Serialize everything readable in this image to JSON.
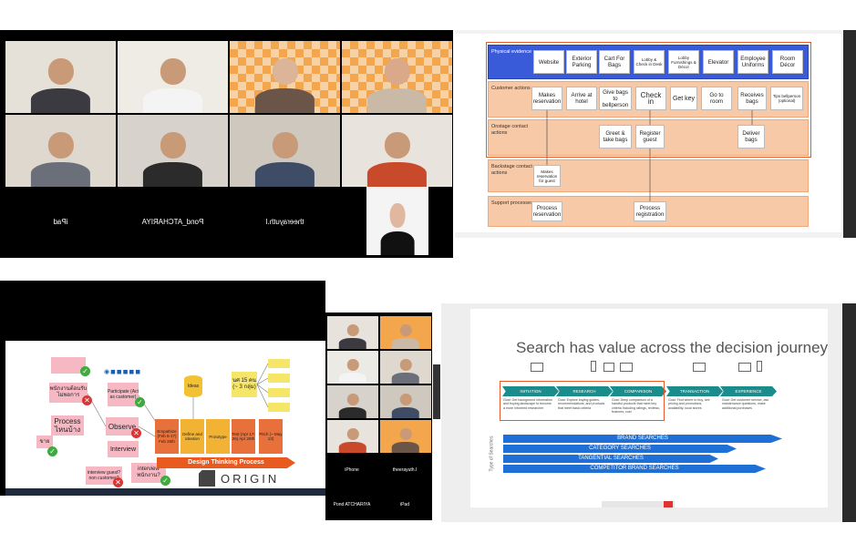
{
  "zoom1": {
    "tiles": [
      {
        "name": "",
        "footer": ""
      },
      {
        "name": "",
        "footer": ""
      },
      {
        "name": "",
        "footer": ""
      },
      {
        "name": "",
        "footer": ""
      },
      {
        "name": "",
        "footer": ""
      },
      {
        "name": "",
        "footer": ""
      },
      {
        "name": "",
        "footer": ""
      },
      {
        "name": "",
        "footer": ""
      }
    ],
    "bottom_names": [
      "iPad",
      "Pond_ATCHARIYA",
      "theerayuth.l"
    ]
  },
  "blueprint": {
    "lanes": [
      "Physical evidence",
      "Customer actions",
      "Onstage contact actions",
      "Backstage contact actions",
      "Support processes"
    ],
    "evidence": [
      "Website",
      "Exterior Parking",
      "Cart For Bags",
      "Lobby & Check in Desk",
      "Lobby Furnishings & Décor",
      "Elevator",
      "Employee Uniforms",
      "Room Décor"
    ],
    "customer": [
      "Makes reservation",
      "Arrive at hotel",
      "Give bags to bellperson",
      "Check in",
      "Get key",
      "Go to room",
      "Receives bags",
      "Tips bellperson (optional)"
    ],
    "onstage": [
      "Greet & take bags",
      "Register guest",
      "Deliver bags"
    ],
    "backstage": [
      "Makes reservation for guest"
    ],
    "support": [
      "Process reservation",
      "Process registration"
    ]
  },
  "design_thinking": {
    "notes": {
      "pink1": "พนักงานต้อนรับไม่พอการ",
      "process": "Process ไหนบ้าง",
      "sell": "ขาย",
      "observe": "Observe",
      "interview": "Interview",
      "participate": "Participate (Act as customer)",
      "iv_guest": "interview guest? non customer?",
      "iv_staff": "interview พนักงาน?",
      "ideas": "Ideas",
      "count": "นศ 15 คน (~ 3 กลุ่ม)"
    },
    "stages": [
      {
        "label": "Empathize (Feb 6-17) Feb 26th",
        "color": "#e8703b"
      },
      {
        "label": "Define and ideation",
        "color": "#f2b233"
      },
      {
        "label": "Prototype",
        "color": "#f2b233"
      },
      {
        "label": "Test (Apr 17-26) Apr 29th",
        "color": "#e8703b"
      },
      {
        "label": "Pitch (~ May 13)",
        "color": "#e8703b"
      }
    ],
    "process_label": "Design Thinking Process",
    "brand": "ORIGIN"
  },
  "zoom2": {
    "labels": [
      "iPhone",
      "theerayuth.l",
      "Pond ATCHARIYA",
      "iPad"
    ]
  },
  "search_slide": {
    "title": "Search has value across the decision journey",
    "phases": [
      "INITIATION",
      "RESEARCH",
      "COMPARISON",
      "TRANSACTION",
      "EXPERIENCE"
    ],
    "goals": [
      "Goal: Get background information and buying landscape to become a more informed researcher",
      "Goal: Explore buying guides, recommendations, and products that meet basic criteria",
      "Goal: Deep comparison of a handful products that meet key criteria including ratings, reviews, features, cost",
      "Goal: Find where to buy, see pricing and promotions, availability, local stores",
      "Goal: Get customer service, ask maintenance questions, make additional purchases"
    ],
    "bars": [
      "BRAND SEARCHES",
      "CATEGORY SEARCHES",
      "TANGENTIAL SEARCHES",
      "COMPETITOR BRAND SEARCHES"
    ],
    "axis": "Type of Searches"
  },
  "colors": {
    "accent": "#e8703b",
    "blue": "#1e6fd6",
    "teal": "#1a8c8c"
  }
}
